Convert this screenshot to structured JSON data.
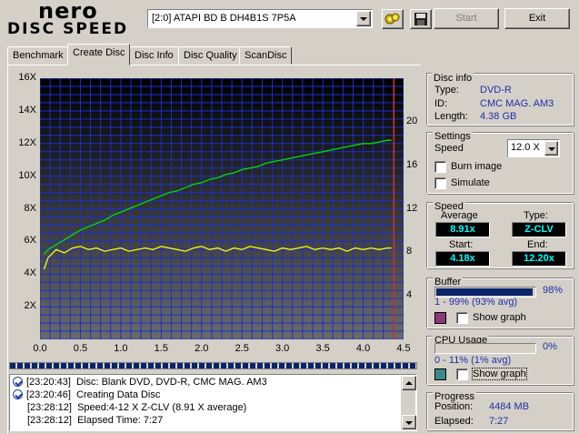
{
  "app": {
    "logo_top": "nero",
    "logo_bottom": "DISC SPEED"
  },
  "toolbar": {
    "drive": "[2:0]   ATAPI BD  B  DH4B1S 7P5A",
    "start_label": "Start",
    "exit_label": "Exit",
    "icons": [
      "drive-config-icon",
      "save-icon"
    ]
  },
  "tabs": [
    "Benchmark",
    "Create Disc",
    "Disc Info",
    "Disc Quality",
    "ScanDisc"
  ],
  "active_tab": "Create Disc",
  "chart_data": {
    "type": "line",
    "x_ticks": [
      "0.0",
      "0.5",
      "1.0",
      "1.5",
      "2.0",
      "2.5",
      "3.0",
      "3.5",
      "4.0",
      "4.5"
    ],
    "y_left_ticks": [
      "16X",
      "14X",
      "12X",
      "10X",
      "8X",
      "6X",
      "4X",
      "2X"
    ],
    "y_right_ticks": [
      "20",
      "16",
      "12",
      "8",
      "4"
    ],
    "xlim": [
      0,
      4.5
    ],
    "ylim_left": [
      0,
      16
    ],
    "ylim_right": [
      0,
      24
    ],
    "grid": true,
    "end_marker_x": 4.38,
    "series": [
      {
        "color": "#00e000",
        "x": [
          0.05,
          0.1,
          0.2,
          0.3,
          0.4,
          0.5,
          0.6,
          0.7,
          0.8,
          0.9,
          1.0,
          1.1,
          1.2,
          1.3,
          1.4,
          1.5,
          1.6,
          1.7,
          1.8,
          1.9,
          2.0,
          2.1,
          2.2,
          2.3,
          2.4,
          2.5,
          2.6,
          2.7,
          2.8,
          2.9,
          3.0,
          3.1,
          3.2,
          3.3,
          3.4,
          3.5,
          3.6,
          3.7,
          3.8,
          3.9,
          4.0,
          4.1,
          4.2,
          4.3,
          4.35
        ],
        "values": [
          5.2,
          5.5,
          5.8,
          6.1,
          6.4,
          6.7,
          6.9,
          7.1,
          7.3,
          7.6,
          7.8,
          8.0,
          8.2,
          8.4,
          8.6,
          8.8,
          9.0,
          9.1,
          9.3,
          9.5,
          9.6,
          9.8,
          9.9,
          10.1,
          10.2,
          10.4,
          10.5,
          10.6,
          10.8,
          10.9,
          11.0,
          11.1,
          11.2,
          11.3,
          11.4,
          11.5,
          11.6,
          11.7,
          11.8,
          11.9,
          12.0,
          12.0,
          12.1,
          12.2,
          12.2
        ]
      },
      {
        "color": "#ffff00",
        "x": [
          0.05,
          0.1,
          0.2,
          0.3,
          0.4,
          0.5,
          0.6,
          0.7,
          0.8,
          0.9,
          1.0,
          1.1,
          1.2,
          1.3,
          1.4,
          1.5,
          1.6,
          1.7,
          1.8,
          1.9,
          2.0,
          2.1,
          2.2,
          2.3,
          2.4,
          2.5,
          2.6,
          2.7,
          2.8,
          2.9,
          3.0,
          3.1,
          3.2,
          3.3,
          3.4,
          3.5,
          3.6,
          3.7,
          3.8,
          3.9,
          4.0,
          4.1,
          4.2,
          4.3,
          4.35
        ],
        "values": [
          4.3,
          5.0,
          5.5,
          5.3,
          5.6,
          5.7,
          5.5,
          5.6,
          5.4,
          5.5,
          5.6,
          5.4,
          5.5,
          5.6,
          5.5,
          5.7,
          5.6,
          5.5,
          5.4,
          5.6,
          5.7,
          5.5,
          5.6,
          5.4,
          5.6,
          5.5,
          5.7,
          5.6,
          5.5,
          5.4,
          5.6,
          5.5,
          5.6,
          5.7,
          5.5,
          5.6,
          5.5,
          5.6,
          5.4,
          5.6,
          5.5,
          5.6,
          5.5,
          5.6,
          5.6
        ]
      }
    ]
  },
  "log": [
    {
      "time": "[23:20:43]",
      "text": "Disc: Blank DVD, DVD-R, CMC MAG. AM3",
      "icon": true
    },
    {
      "time": "[23:20:46]",
      "text": "Creating Data Disc",
      "icon": true
    },
    {
      "time": "[23:28:12]",
      "text": "Speed:4-12 X Z-CLV (8.91 X average)",
      "icon": false
    },
    {
      "time": "[23:28:12]",
      "text": "Elapsed Time:  7:27",
      "icon": false
    }
  ],
  "disc_info": {
    "title": "Disc info",
    "type_label": "Type:",
    "type_value": "DVD-R",
    "id_label": "ID:",
    "id_value": "CMC MAG. AM3",
    "length_label": "Length:",
    "length_value": "4.38 GB"
  },
  "settings": {
    "title": "Settings",
    "speed_label": "Speed",
    "speed_value": "12.0 X",
    "burn_image_label": "Burn image",
    "simulate_label": "Simulate"
  },
  "speed": {
    "title": "Speed",
    "average_label": "Average",
    "average_value": "8.91x",
    "type_label": "Type:",
    "type_value": "Z-CLV",
    "start_label": "Start:",
    "start_value": "4.18x",
    "end_label": "End:",
    "end_value": "12.20x"
  },
  "buffer": {
    "title": "Buffer",
    "percent": "98%",
    "fill": 0.98,
    "range": "1 - 99% (93% avg)",
    "show_graph_label": "Show graph",
    "swatch_color": "#8b3a7a"
  },
  "cpu": {
    "title": "CPU Usage",
    "percent": "0%",
    "fill": 0.0,
    "range": "0 - 11% (1% avg)",
    "show_graph_label": "Show graph",
    "swatch_color": "#3a8a8a"
  },
  "progress": {
    "title": "Progress",
    "position_label": "Position:",
    "position_value": "4484 MB",
    "elapsed_label": "Elapsed:",
    "elapsed_value": "7:27"
  }
}
